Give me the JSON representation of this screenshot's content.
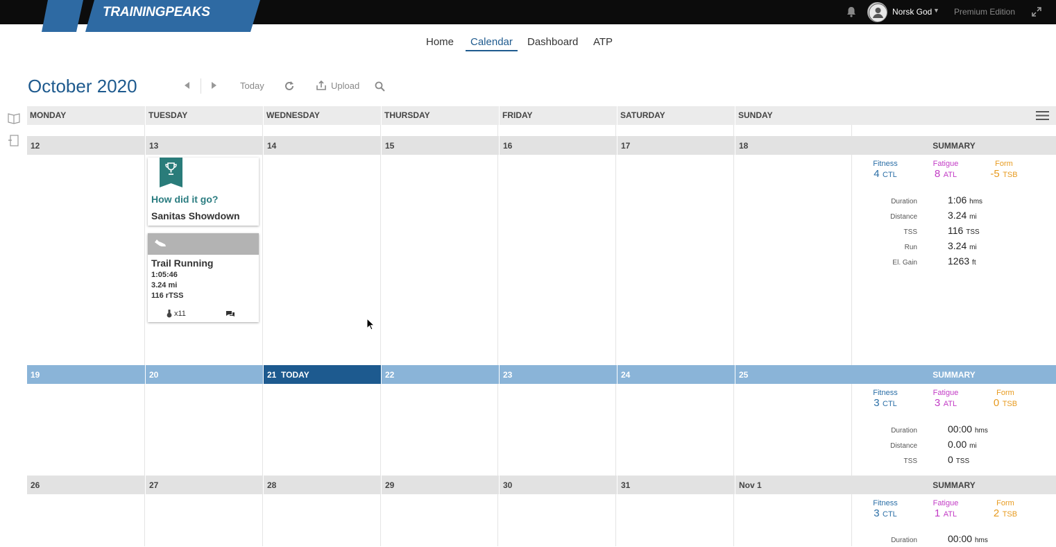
{
  "app": {
    "logo_text": "TRAININGPEAKS",
    "username": "Norsk God",
    "edition": "Premium Edition"
  },
  "nav": {
    "home": "Home",
    "calendar": "Calendar",
    "dashboard": "Dashboard",
    "atp": "ATP"
  },
  "calendar": {
    "month": "October",
    "year": "2020",
    "toolbar": {
      "today": "Today",
      "upload": "Upload"
    },
    "day_names": [
      "MONDAY",
      "TUESDAY",
      "WEDNESDAY",
      "THURSDAY",
      "FRIDAY",
      "SATURDAY",
      "SUNDAY"
    ],
    "summary_label": "SUMMARY",
    "today_label": "TODAY",
    "metric_labels": {
      "fitness": "Fitness",
      "fatigue": "Fatigue",
      "form": "Form",
      "ctl": "CTL",
      "atl": "ATL",
      "tsb": "TSB"
    },
    "weeks": [
      {
        "days": [
          "12",
          "13",
          "14",
          "15",
          "16",
          "17",
          "18"
        ],
        "summary": {
          "fitness": "4",
          "fatigue": "8",
          "form": "-5",
          "stats": [
            {
              "label": "Duration",
              "value": "1:06",
              "unit": "hms"
            },
            {
              "label": "Distance",
              "value": "3.24",
              "unit": "mi"
            },
            {
              "label": "TSS",
              "value": "116",
              "unit": "TSS"
            },
            {
              "label": "Run",
              "value": "3.24",
              "unit": "mi"
            },
            {
              "label": "El. Gain",
              "value": "1263",
              "unit": "ft"
            }
          ]
        }
      },
      {
        "days": [
          "19",
          "20",
          "21",
          "22",
          "23",
          "24",
          "25"
        ],
        "summary": {
          "fitness": "3",
          "fatigue": "3",
          "form": "0",
          "stats": [
            {
              "label": "Duration",
              "value": "00:00",
              "unit": "hms"
            },
            {
              "label": "Distance",
              "value": "0.00",
              "unit": "mi"
            },
            {
              "label": "TSS",
              "value": "0",
              "unit": "TSS"
            }
          ]
        }
      },
      {
        "days": [
          "26",
          "27",
          "28",
          "29",
          "30",
          "31",
          "Nov 1"
        ],
        "summary": {
          "fitness": "3",
          "fatigue": "1",
          "form": "2",
          "stats": [
            {
              "label": "Duration",
              "value": "00:00",
              "unit": "hms"
            }
          ]
        }
      }
    ],
    "event": {
      "question": "How did it go?",
      "name": "Sanitas Showdown"
    },
    "workout": {
      "title": "Trail Running",
      "duration": "1:05:46",
      "distance": "3.24 mi",
      "tss": "116 rTSS",
      "likes": "x11"
    }
  },
  "icons": {
    "bell": "bell-icon",
    "expand": "expand-icon",
    "prev": "chevron-left-icon",
    "next": "chevron-right-icon",
    "refresh": "refresh-icon",
    "upload": "upload-icon",
    "search": "search-icon",
    "menu": "hamburger-menu-icon",
    "trophy": "trophy-icon",
    "shoe": "running-shoe-icon",
    "comment": "comment-icon",
    "library": "library-book-icon",
    "plans": "plans-icon"
  },
  "colors": {
    "brand_blue": "#1e5a8e",
    "fitness": "#2a6ea6",
    "fatigue": "#c23bc5",
    "form": "#e79a1e",
    "event_teal": "#2a7c7a",
    "current_week": "#8ab4d8",
    "today": "#1d5a8f"
  }
}
